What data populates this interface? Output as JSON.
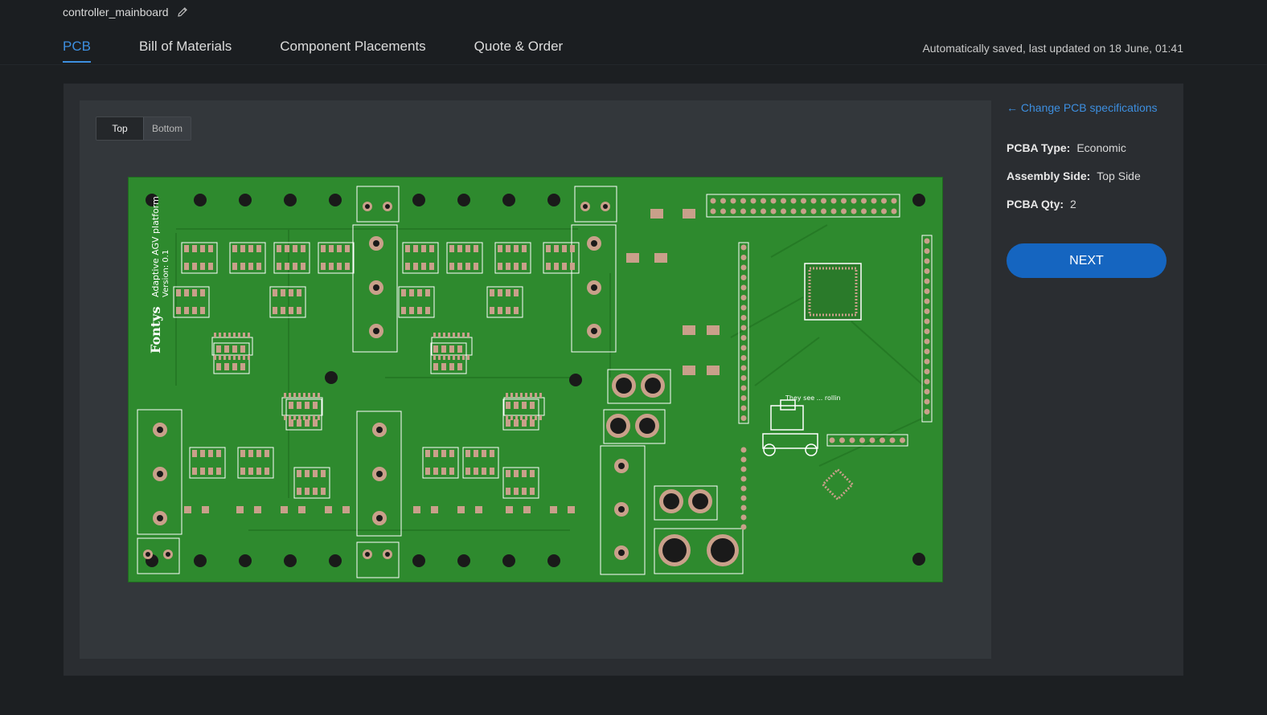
{
  "project": {
    "name": "controller_mainboard",
    "edit_icon": "pencil-icon"
  },
  "tabs": [
    {
      "label": "PCB",
      "active": true
    },
    {
      "label": "Bill of Materials",
      "active": false
    },
    {
      "label": "Component Placements",
      "active": false
    },
    {
      "label": "Quote & Order",
      "active": false
    }
  ],
  "save_status": "Automatically saved, last updated on 18 June, 01:41",
  "viewer": {
    "side_toggle": {
      "top_label": "Top",
      "bottom_label": "Bottom",
      "selected": "Top"
    },
    "board": {
      "title_text": "Adaptive AGV platform",
      "version_text": "Version: 0.1",
      "brand_text": "Fontys",
      "note_text": "They see ... rollin",
      "colors": {
        "soldermask": "#2e8a2e",
        "pad": "#c9a08a",
        "silkscreen": "#ffffff",
        "hole": "#1a1a1a"
      }
    }
  },
  "spec": {
    "change_link": "← Change PCB specifications",
    "pcba_type": {
      "label": "PCBA Type:",
      "value": "Economic"
    },
    "assembly_side": {
      "label": "Assembly Side:",
      "value": "Top Side"
    },
    "pcba_qty": {
      "label": "PCBA Qty:",
      "value": "2"
    },
    "next_label": "NEXT"
  },
  "colors": {
    "accent": "#3d8fe0",
    "button": "#1565c0",
    "background": "#1c1f22"
  }
}
